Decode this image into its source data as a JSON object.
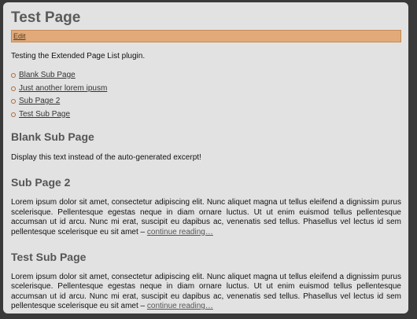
{
  "page": {
    "title": "Test Page",
    "edit_label": "Edit",
    "intro": "Testing the Extended Page List plugin."
  },
  "page_list": [
    {
      "label": "Blank Sub Page"
    },
    {
      "label": "Just another lorem ipusm"
    },
    {
      "label": "Sub Page 2"
    },
    {
      "label": "Test Sub Page"
    }
  ],
  "sections": [
    {
      "title": "Blank Sub Page",
      "text": "Display this text instead of the auto-generated excerpt!",
      "link": ""
    },
    {
      "title": "Sub Page 2",
      "text": "Lorem ipsum dolor sit amet, consectetur adipiscing elit. Nunc aliquet magna ut tellus eleifend a dignissim purus scelerisque. Pellentesque egestas neque in diam ornare luctus. Ut ut enim euismod tellus pellentesque accumsan ut id arcu. Nunc mi erat, suscipit eu dapibus ac, venenatis sed tellus. Phasellus vel lectus id sem pellentesque scelerisque eu sit amet – ",
      "link": "continue reading…"
    },
    {
      "title": "Test Sub Page",
      "text": "Lorem ipsum dolor sit amet, consectetur adipiscing elit. Nunc aliquet magna ut tellus eleifend a dignissim purus scelerisque. Pellentesque egestas neque in diam ornare luctus. Ut ut enim euismod tellus pellentesque accumsan ut id arcu. Nunc mi erat, suscipit eu dapibus ac, venenatis sed tellus. Phasellus vel lectus id sem pellentesque scelerisque eu sit amet – ",
      "link": "continue reading…"
    }
  ],
  "colors": {
    "background": "#3a3a3a",
    "panel": "#e2e2e2",
    "edit_bar": "#e2aa78",
    "heading": "#5a5a5a",
    "bullet": "#b06a3a"
  }
}
